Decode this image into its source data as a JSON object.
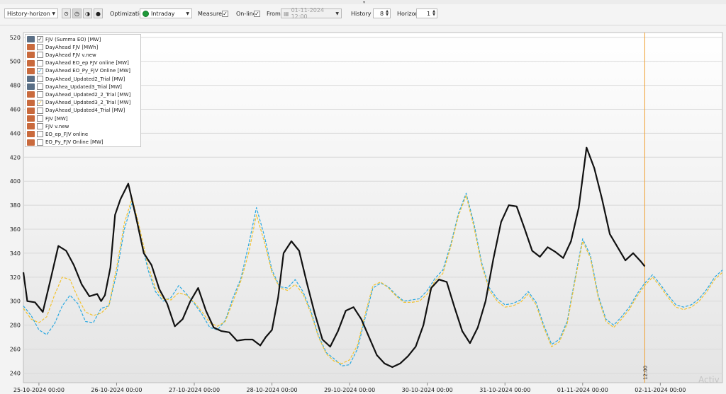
{
  "toolbar": {
    "mode_select": "History-horizon",
    "optimization_label": "Optimization",
    "optimization_value": "Intraday",
    "measured_label": "Measured",
    "measured_checked": true,
    "online_label": "On-line",
    "online_checked": true,
    "from_label": "From",
    "from_value": "01-11-2024 12:00",
    "history_label": "History",
    "history_value": "8",
    "horizon_label": "Horizon",
    "horizon_value": "1"
  },
  "legend": [
    {
      "label": "FJV (Summa EO) [MW]",
      "checked": true,
      "icon": "dark"
    },
    {
      "label": "DayAhead FJV [MWh]",
      "checked": false,
      "icon": "red"
    },
    {
      "label": "DayAhead FJV v.new",
      "checked": false,
      "icon": "red"
    },
    {
      "label": "DayAhead EO_ep FJV online [MW]",
      "checked": false,
      "icon": "red"
    },
    {
      "label": "DayAhead EO_Py_FJV Online [MW]",
      "checked": true,
      "icon": "red"
    },
    {
      "label": "DayAhead_Updated2_Trial [MW]",
      "checked": false,
      "icon": "dark"
    },
    {
      "label": "DayAhea_Updated3_Trial [MW]",
      "checked": false,
      "icon": "dark"
    },
    {
      "label": "DayAhead_Updated2_2_Trial [MW]",
      "checked": false,
      "icon": "red"
    },
    {
      "label": "DayAhead_Updated3_2_Trial [MW]",
      "checked": true,
      "icon": "red"
    },
    {
      "label": "DayAhead_Updated4_Trial [MW]",
      "checked": false,
      "icon": "red"
    },
    {
      "label": "FJV [MW]",
      "checked": false,
      "icon": "red"
    },
    {
      "label": "FJV v.new",
      "checked": false,
      "icon": "red"
    },
    {
      "label": "EO_ep_FJV online",
      "checked": false,
      "icon": "red"
    },
    {
      "label": "EO_Py_FJV Online [MW]",
      "checked": false,
      "icon": "red"
    }
  ],
  "watermark": "Activ",
  "colors": {
    "actual": "#111111",
    "py_forecast": "#2aa8e0",
    "trial_forecast": "#f2c230",
    "now_marker": "#f0a030",
    "grid": "#d9d9d9"
  },
  "chart_data": {
    "type": "line",
    "ylim": [
      232,
      524
    ],
    "yticks": [
      240,
      260,
      280,
      300,
      320,
      340,
      360,
      380,
      400,
      420,
      440,
      460,
      480,
      500,
      520
    ],
    "xticks": [
      "25-10-2024 00:00",
      "26-10-2024 00:00",
      "27-10-2024 00:00",
      "28-10-2024 00:00",
      "29-10-2024 00:00",
      "30-10-2024 00:00",
      "31-10-2024 00:00",
      "01-11-2024 00:00",
      "02-11-2024 00:00"
    ],
    "xtick_day_offsets": [
      0.2,
      1.2,
      2.2,
      3.2,
      4.2,
      5.2,
      6.2,
      7.2,
      8.2
    ],
    "xlim_days": [
      0,
      9
    ],
    "now_marker": {
      "day": 8.0,
      "label": "12:00"
    },
    "series": [
      {
        "name": "FJV (Summa EO) [MW]",
        "color": "#111111",
        "dashed": false,
        "x": [
          0,
          0.05,
          0.15,
          0.25,
          0.35,
          0.45,
          0.55,
          0.65,
          0.75,
          0.85,
          0.95,
          1.0,
          1.05,
          1.12,
          1.18,
          1.25,
          1.35,
          1.45,
          1.55,
          1.65,
          1.75,
          1.85,
          1.95,
          2.05,
          2.15,
          2.25,
          2.35,
          2.45,
          2.55,
          2.65,
          2.75,
          2.85,
          2.95,
          3.05,
          3.12,
          3.2,
          3.28,
          3.35,
          3.45,
          3.55,
          3.65,
          3.75,
          3.85,
          3.95,
          4.05,
          4.15,
          4.25,
          4.35,
          4.45,
          4.55,
          4.65,
          4.75,
          4.85,
          4.95,
          5.05,
          5.15,
          5.25,
          5.35,
          5.45,
          5.55,
          5.65,
          5.75,
          5.85,
          5.95,
          6.05,
          6.15,
          6.25,
          6.35,
          6.45,
          6.55,
          6.65,
          6.75,
          6.85,
          6.95,
          7.05,
          7.15,
          7.25,
          7.35,
          7.45,
          7.55,
          7.65,
          7.75,
          7.85,
          7.95,
          8.0
        ],
        "y": [
          324,
          300,
          299,
          291,
          318,
          346,
          342,
          330,
          314,
          304,
          306,
          300,
          305,
          328,
          372,
          385,
          398,
          370,
          340,
          330,
          310,
          298,
          279,
          285,
          300,
          311,
          292,
          278,
          275,
          274,
          267,
          268,
          268,
          263,
          270,
          276,
          303,
          340,
          350,
          342,
          315,
          290,
          268,
          262,
          275,
          292,
          295,
          285,
          270,
          255,
          248,
          245,
          248,
          254,
          262,
          280,
          311,
          318,
          316,
          295,
          275,
          265,
          278,
          300,
          335,
          366,
          380,
          379,
          361,
          342,
          337,
          345,
          341,
          336,
          350,
          378,
          428,
          411,
          385,
          356,
          345,
          334,
          340,
          333,
          329
        ]
      },
      {
        "name": "DayAhead EO_Py_FJV Online [MW]",
        "color": "#2aa8e0",
        "dashed": true,
        "x": [
          0,
          0.1,
          0.2,
          0.3,
          0.4,
          0.5,
          0.6,
          0.7,
          0.8,
          0.9,
          1.0,
          1.1,
          1.2,
          1.3,
          1.4,
          1.5,
          1.6,
          1.7,
          1.8,
          1.9,
          2.0,
          2.1,
          2.2,
          2.3,
          2.4,
          2.5,
          2.6,
          2.7,
          2.8,
          2.9,
          3.0,
          3.1,
          3.2,
          3.3,
          3.4,
          3.5,
          3.6,
          3.7,
          3.8,
          3.9,
          4.0,
          4.1,
          4.2,
          4.3,
          4.4,
          4.5,
          4.6,
          4.7,
          4.8,
          4.9,
          5.0,
          5.1,
          5.2,
          5.3,
          5.4,
          5.5,
          5.6,
          5.7,
          5.8,
          5.9,
          6.0,
          6.1,
          6.2,
          6.3,
          6.4,
          6.5,
          6.6,
          6.7,
          6.8,
          6.9,
          7.0,
          7.1,
          7.2,
          7.3,
          7.4,
          7.5,
          7.6,
          7.7,
          7.8,
          7.9,
          8.0,
          8.1,
          8.2,
          8.3,
          8.4,
          8.5,
          8.6,
          8.7,
          8.8,
          8.9,
          9.0
        ],
        "y": [
          296,
          288,
          276,
          272,
          281,
          296,
          305,
          298,
          283,
          282,
          294,
          296,
          323,
          360,
          382,
          356,
          327,
          308,
          300,
          303,
          313,
          306,
          298,
          289,
          278,
          276,
          284,
          303,
          319,
          347,
          378,
          355,
          326,
          312,
          311,
          318,
          308,
          292,
          271,
          257,
          252,
          246,
          247,
          260,
          286,
          311,
          315,
          312,
          305,
          300,
          301,
          302,
          309,
          319,
          326,
          347,
          373,
          390,
          365,
          332,
          311,
          302,
          297,
          298,
          301,
          308,
          299,
          280,
          264,
          268,
          283,
          318,
          352,
          338,
          305,
          285,
          280,
          287,
          295,
          306,
          315,
          322,
          314,
          305,
          297,
          295,
          297,
          302,
          310,
          320,
          326
        ]
      },
      {
        "name": "DayAhead_Updated3_2_Trial [MW]",
        "color": "#f2c230",
        "dashed": true,
        "x": [
          0,
          0.1,
          0.2,
          0.3,
          0.4,
          0.5,
          0.6,
          0.7,
          0.8,
          0.9,
          1.0,
          1.1,
          1.2,
          1.3,
          1.4,
          1.5,
          1.6,
          1.7,
          1.8,
          1.9,
          2.0,
          2.1,
          2.2,
          2.3,
          2.4,
          2.5,
          2.6,
          2.7,
          2.8,
          2.9,
          3.0,
          3.1,
          3.2,
          3.3,
          3.4,
          3.5,
          3.6,
          3.7,
          3.8,
          3.9,
          4.0,
          4.1,
          4.2,
          4.3,
          4.4,
          4.5,
          4.6,
          4.7,
          4.8,
          4.9,
          5.0,
          5.1,
          5.2,
          5.3,
          5.4,
          5.5,
          5.6,
          5.7,
          5.8,
          5.9,
          6.0,
          6.1,
          6.2,
          6.3,
          6.4,
          6.5,
          6.6,
          6.7,
          6.8,
          6.9,
          7.0,
          7.1,
          7.2,
          7.3,
          7.4,
          7.5,
          7.6,
          7.7,
          7.8,
          7.9,
          8.0,
          8.1,
          8.2,
          8.3,
          8.4,
          8.5,
          8.6,
          8.7,
          8.8,
          8.9,
          9.0
        ],
        "y": [
          294,
          285,
          282,
          287,
          305,
          320,
          318,
          303,
          291,
          288,
          290,
          296,
          328,
          365,
          386,
          360,
          331,
          311,
          302,
          301,
          307,
          305,
          299,
          291,
          282,
          279,
          283,
          300,
          317,
          340,
          372,
          350,
          324,
          311,
          309,
          314,
          306,
          290,
          270,
          256,
          250,
          248,
          251,
          263,
          289,
          313,
          316,
          311,
          304,
          299,
          299,
          300,
          306,
          317,
          323,
          345,
          371,
          388,
          362,
          330,
          309,
          300,
          295,
          296,
          299,
          306,
          297,
          278,
          262,
          266,
          281,
          316,
          350,
          336,
          303,
          283,
          278,
          285,
          293,
          304,
          313,
          320,
          312,
          303,
          295,
          293,
          295,
          300,
          308,
          318,
          324
        ]
      }
    ]
  }
}
